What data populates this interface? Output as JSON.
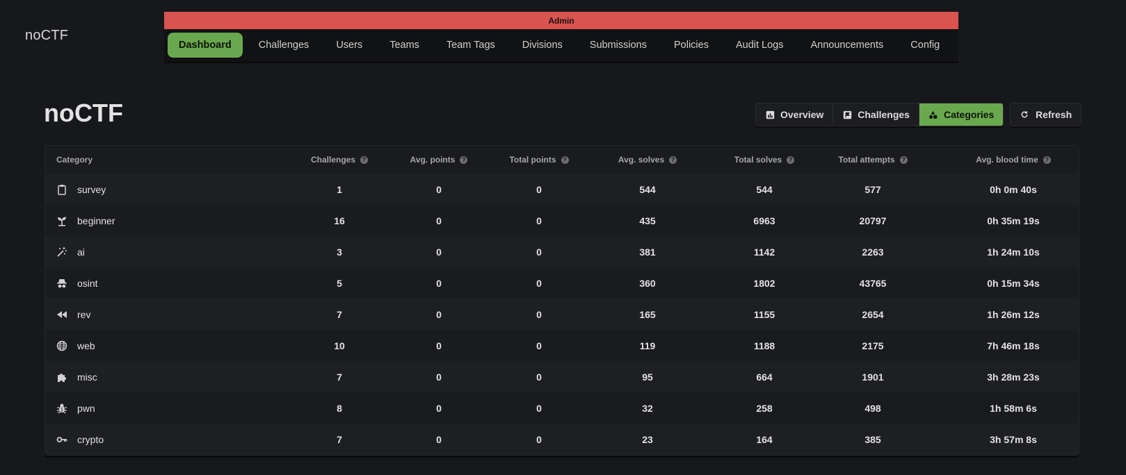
{
  "brand": "noCTF",
  "admin_label": "Admin",
  "nav": [
    {
      "label": "Dashboard",
      "active": true
    },
    {
      "label": "Challenges",
      "active": false
    },
    {
      "label": "Users",
      "active": false
    },
    {
      "label": "Teams",
      "active": false
    },
    {
      "label": "Team Tags",
      "active": false
    },
    {
      "label": "Divisions",
      "active": false
    },
    {
      "label": "Submissions",
      "active": false
    },
    {
      "label": "Policies",
      "active": false
    },
    {
      "label": "Audit Logs",
      "active": false
    },
    {
      "label": "Announcements",
      "active": false
    },
    {
      "label": "Config",
      "active": false
    }
  ],
  "page_title": "noCTF",
  "views": [
    {
      "label": "Overview",
      "icon": "bar-chart-icon",
      "active": false
    },
    {
      "label": "Challenges",
      "icon": "flag-icon",
      "active": false
    },
    {
      "label": "Categories",
      "icon": "shapes-icon",
      "active": true
    }
  ],
  "refresh_label": "Refresh",
  "table": {
    "headers": [
      "Category",
      "Challenges",
      "Avg. points",
      "Total points",
      "Avg. solves",
      "Total solves",
      "Total attempts",
      "Avg. blood time"
    ],
    "rows": [
      {
        "icon": "clipboard-icon",
        "name": "survey",
        "challenges": "1",
        "avg_points": "0",
        "total_points": "0",
        "avg_solves": "544",
        "total_solves": "544",
        "total_attempts": "577",
        "avg_blood": "0h 0m 40s"
      },
      {
        "icon": "sprout-icon",
        "name": "beginner",
        "challenges": "16",
        "avg_points": "0",
        "total_points": "0",
        "avg_solves": "435",
        "total_solves": "6963",
        "total_attempts": "20797",
        "avg_blood": "0h 35m 19s"
      },
      {
        "icon": "magic-wand-icon",
        "name": "ai",
        "challenges": "3",
        "avg_points": "0",
        "total_points": "0",
        "avg_solves": "381",
        "total_solves": "1142",
        "total_attempts": "2263",
        "avg_blood": "1h 24m 10s"
      },
      {
        "icon": "spy-icon",
        "name": "osint",
        "challenges": "5",
        "avg_points": "0",
        "total_points": "0",
        "avg_solves": "360",
        "total_solves": "1802",
        "total_attempts": "43765",
        "avg_blood": "0h 15m 34s"
      },
      {
        "icon": "rewind-icon",
        "name": "rev",
        "challenges": "7",
        "avg_points": "0",
        "total_points": "0",
        "avg_solves": "165",
        "total_solves": "1155",
        "total_attempts": "2654",
        "avg_blood": "1h 26m 12s"
      },
      {
        "icon": "globe-icon",
        "name": "web",
        "challenges": "10",
        "avg_points": "0",
        "total_points": "0",
        "avg_solves": "119",
        "total_solves": "1188",
        "total_attempts": "2175",
        "avg_blood": "7h 46m 18s"
      },
      {
        "icon": "puzzle-icon",
        "name": "misc",
        "challenges": "7",
        "avg_points": "0",
        "total_points": "0",
        "avg_solves": "95",
        "total_solves": "664",
        "total_attempts": "1901",
        "avg_blood": "3h 28m 23s"
      },
      {
        "icon": "bug-icon",
        "name": "pwn",
        "challenges": "8",
        "avg_points": "0",
        "total_points": "0",
        "avg_solves": "32",
        "total_solves": "258",
        "total_attempts": "498",
        "avg_blood": "1h 58m 6s"
      },
      {
        "icon": "key-icon",
        "name": "crypto",
        "challenges": "7",
        "avg_points": "0",
        "total_points": "0",
        "avg_solves": "23",
        "total_solves": "164",
        "total_attempts": "385",
        "avg_blood": "3h 57m 8s"
      }
    ]
  },
  "colors": {
    "accent": "#6aa84f",
    "admin_bar": "#d9534f",
    "background": "#17181c"
  }
}
